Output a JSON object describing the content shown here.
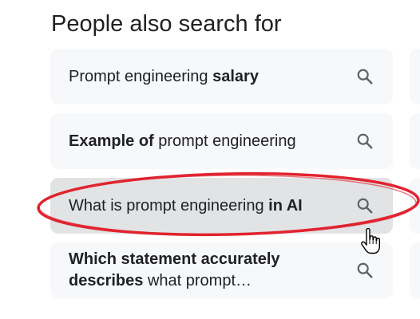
{
  "section": {
    "heading": "People also search for"
  },
  "suggestions": [
    {
      "plain_before": "Prompt engineering ",
      "bold": "salary",
      "plain_after": "",
      "line2_bold": "",
      "line2_plain": ""
    },
    {
      "plain_before": "",
      "bold": "Example of",
      "plain_after": " prompt engineering",
      "line2_bold": "",
      "line2_plain": ""
    },
    {
      "plain_before": "What is prompt engineering ",
      "bold": "in AI",
      "plain_after": "",
      "line2_bold": "",
      "line2_plain": ""
    },
    {
      "plain_before": "",
      "bold": "Which statement accurately",
      "plain_after": "",
      "line2_bold": "describes",
      "line2_plain": " what prompt…"
    }
  ],
  "icons": {
    "suggestion_action": "search-icon",
    "pointer": "hand-pointer-icon"
  },
  "colors": {
    "annotation_ellipse": "#e0242f",
    "card_background": "#f7f8fa",
    "card_hover_background": "#e2e3e5",
    "icon": "#5f6368",
    "text": "#202124"
  },
  "state": {
    "hovered_suggestion_index": 2
  }
}
